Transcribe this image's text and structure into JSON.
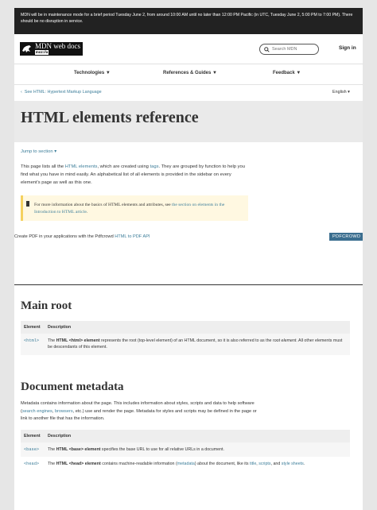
{
  "banner": {
    "text": "MDN will be in maintenance mode for a brief period Tuesday June 2, from around 10:00 AM until no later than 12:00 PM Pacific (in UTC, Tuesday June 2, 5:00 PM to 7:00 PM). There should be no disruption in service."
  },
  "header": {
    "logo_name": "MDN web docs",
    "logo_sub": "moz://a",
    "search_placeholder": "Search MDN",
    "signin": "Sign in"
  },
  "nav": {
    "items": [
      {
        "label": "Technologies ▼"
      },
      {
        "label": "References & Guides ▼"
      },
      {
        "label": "Feedback ▼"
      }
    ]
  },
  "breadcrumb": {
    "back": "See HTML: Hypertext Markup Language",
    "language": "English ▾"
  },
  "page": {
    "title": "HTML elements reference",
    "jump": "Jump to section ▾",
    "intro_1": "This page lists all the ",
    "intro_link1": "HTML elements",
    "intro_2": ", which are created using ",
    "intro_link2": "tags",
    "intro_3": ". They are grouped by function to help you find what you have in mind easily. An alphabetical list of all elements is provided in the sidebar on every element's page as well as this one.",
    "note_1": "For more information about the basics of HTML elements and attributes, see ",
    "note_link": "the section on elements in the Introduction to HTML article",
    "note_2": "."
  },
  "pdfcrowd": {
    "text": "Create PDF in your applications with the Pdfcrowd ",
    "link": "HTML to PDF API",
    "button": "PDFCROWD"
  },
  "main_root": {
    "heading": "Main root",
    "col_element": "Element",
    "col_description": "Description",
    "rows": [
      {
        "element": "<html>",
        "d1": "The ",
        "d_bold": "HTML <html> element",
        "d2": " represents the root (top-level element) of an HTML document, so it is also referred to as the ",
        "d_em": "root element",
        "d3": ". All other elements must be descendants of this element."
      }
    ]
  },
  "metadata": {
    "heading": "Document metadata",
    "text_1": "Metadata contains information about the page. This includes information about styles, scripts and data to help software (",
    "link1": "search engines",
    "text_2": ", ",
    "link2": "browsers",
    "text_3": ", etc.) use and render the page. Metadata for styles and scripts may be defined in the page or link to another file that has the information.",
    "col_element": "Element",
    "col_description": "Description",
    "rows": [
      {
        "element": "<base>",
        "d1": "The ",
        "d_bold": "HTML <base> element",
        "d2": " specifies the base URL to use for all relative URLs in a document."
      },
      {
        "element": "<head>",
        "d1": "The ",
        "d_bold": "HTML <head> element",
        "d2": " contains machine-readable information (",
        "l1": "metadata",
        "d3": ") about the document, like its ",
        "l2": "title",
        "d4": ", ",
        "l3": "scripts",
        "d5": ", and ",
        "l4": "style sheets",
        "d6": "."
      }
    ]
  }
}
